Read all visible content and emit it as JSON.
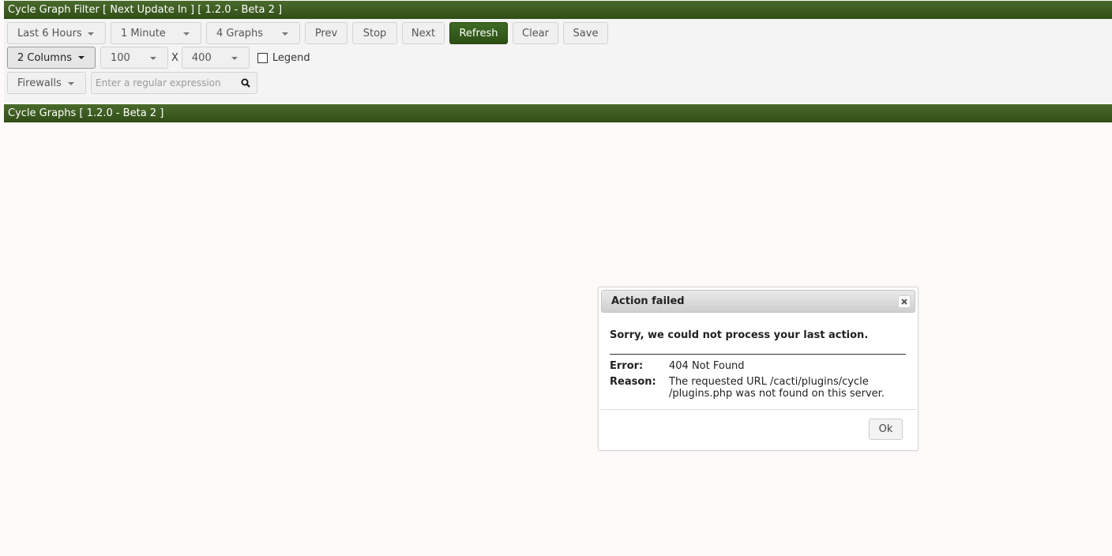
{
  "filter_panel": {
    "title": "Cycle Graph Filter [ Next Update In ] [ 1.2.0 - Beta 2 ]",
    "timespan": "Last 6 Hours",
    "refresh_interval": "1 Minute",
    "graph_count": "4 Graphs",
    "buttons": {
      "prev": "Prev",
      "stop": "Stop",
      "next": "Next",
      "refresh": "Refresh",
      "clear": "Clear",
      "save": "Save"
    },
    "columns": "2 Columns",
    "height": "100",
    "x_sep": "X",
    "width": "400",
    "legend_label": "Legend",
    "legend_checked": false,
    "tree": "Firewalls",
    "search_placeholder": "Enter a regular expression"
  },
  "graphs_panel": {
    "title": "Cycle Graphs [ 1.2.0 - Beta 2 ]"
  },
  "dialog": {
    "title": "Action failed",
    "message": "Sorry, we could not process your last action.",
    "error_label": "Error:",
    "error_value": "404 Not Found",
    "reason_label": "Reason:",
    "reason_line1": "The requested URL /cacti/plugins/cycle",
    "reason_line2": "/plugins.php was not found on this server.",
    "ok_label": "Ok"
  },
  "colors": {
    "header_green": "#3a5c20",
    "refresh_green": "#355c1c",
    "background": "#fdfaf9"
  }
}
